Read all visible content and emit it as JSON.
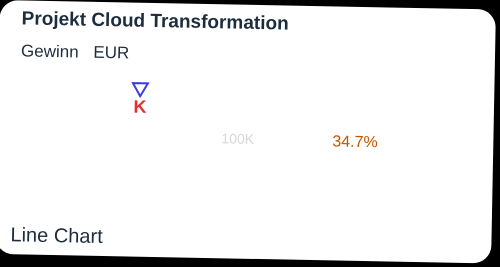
{
  "card": {
    "title": "Projekt Cloud Transformation",
    "subtitle": "Gewinn",
    "unit": "EUR",
    "trend_icon": "triangle-down-icon",
    "scale": "K",
    "target": "100K",
    "deviation": "34.7%",
    "footer": "Line Chart"
  },
  "colors": {
    "trend_icon": "#3b3be0",
    "scale": "#e62e2e",
    "deviation": "#c35500",
    "target": "#d6d6d6",
    "text": "#1d2d3e"
  }
}
